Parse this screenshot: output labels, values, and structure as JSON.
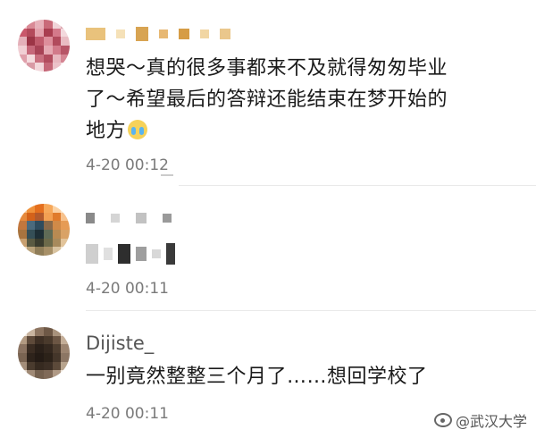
{
  "comments": [
    {
      "author": "",
      "text_line1": "想哭～真的很多事都来不及就得匆匆毕业",
      "text_line2": "了～希望最后的答辩还能结束在梦开始的",
      "text_line3": "地方",
      "emoji_icon": "crying-face-icon",
      "time": "4-20 00:12"
    },
    {
      "author": "",
      "text": "",
      "time": "4-20 00:11"
    },
    {
      "author": "Dijiste_",
      "text": "一别竟然整整三个月了……想回学校了",
      "time": "4-20 00:11"
    }
  ],
  "watermark": {
    "icon": "weibo-icon",
    "text": "@武汉大学"
  },
  "colors": {
    "background": "#ffffff",
    "text": "#1a1a1a",
    "time": "#7a7a7a",
    "divider": "#e9e9e9"
  }
}
